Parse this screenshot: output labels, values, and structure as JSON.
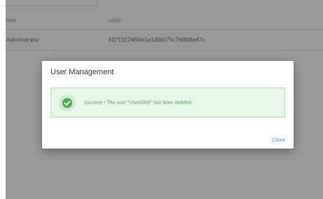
{
  "table": {
    "headers": {
      "role": "Role",
      "uuid": "UUID"
    },
    "rows": [
      {
        "role": "Administrator",
        "uuid": "93713224f56e1e1d0b075c76f808a47c"
      }
    ]
  },
  "dialog": {
    "title": "User Management",
    "message": "Success ! The user \"User0000\" has been deleted.",
    "close_label": "Close",
    "status_icon": "check-circle-icon"
  },
  "colors": {
    "success_bg": "#e8f5e9",
    "success_border": "#b8e0bb",
    "success_icon": "#4caf50",
    "success_text": "#4caf50",
    "link": "#3a8fd6"
  }
}
